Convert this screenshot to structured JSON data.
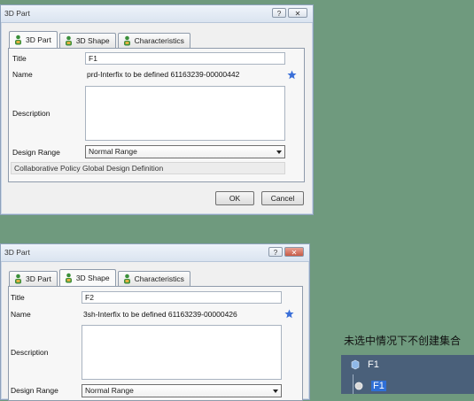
{
  "dialog1": {
    "title": "3D Part",
    "help_button": "?",
    "close_button": "✕",
    "tabs": [
      {
        "label": "3D Part",
        "active": true
      },
      {
        "label": "3D Shape",
        "active": false
      },
      {
        "label": "Characteristics",
        "active": false
      }
    ],
    "title_label": "Title",
    "title_value": "F1",
    "name_label": "Name",
    "name_value": "prd-Interfix to be defined 61163239-00000442",
    "description_label": "Description",
    "design_range_label": "Design Range",
    "design_range_value": "Normal Range",
    "collab_label": "Collaborative Policy",
    "collab_value": "Global Design Definition",
    "ok_label": "OK",
    "cancel_label": "Cancel"
  },
  "dialog2": {
    "title": "3D Part",
    "help_button": "?",
    "close_button": "✕",
    "tabs": [
      {
        "label": "3D Part",
        "active": false
      },
      {
        "label": "3D Shape",
        "active": true
      },
      {
        "label": "Characteristics",
        "active": false
      }
    ],
    "title_label": "Title",
    "title_value": "F2",
    "name_label": "Name",
    "name_value": "3sh-Interfix to be defined 61163239-00000426",
    "description_label": "Description",
    "design_range_label": "Design Range",
    "design_range_value": "Normal Range"
  },
  "caption": "未选中情况下不创建集合",
  "tree": {
    "root_label": "F1",
    "child_label": "F1"
  },
  "colors": {
    "background": "#6f9a7e",
    "accent_star": "#3a6fd8",
    "tree_bg": "#4a607a",
    "selection": "#2f6fd6"
  }
}
